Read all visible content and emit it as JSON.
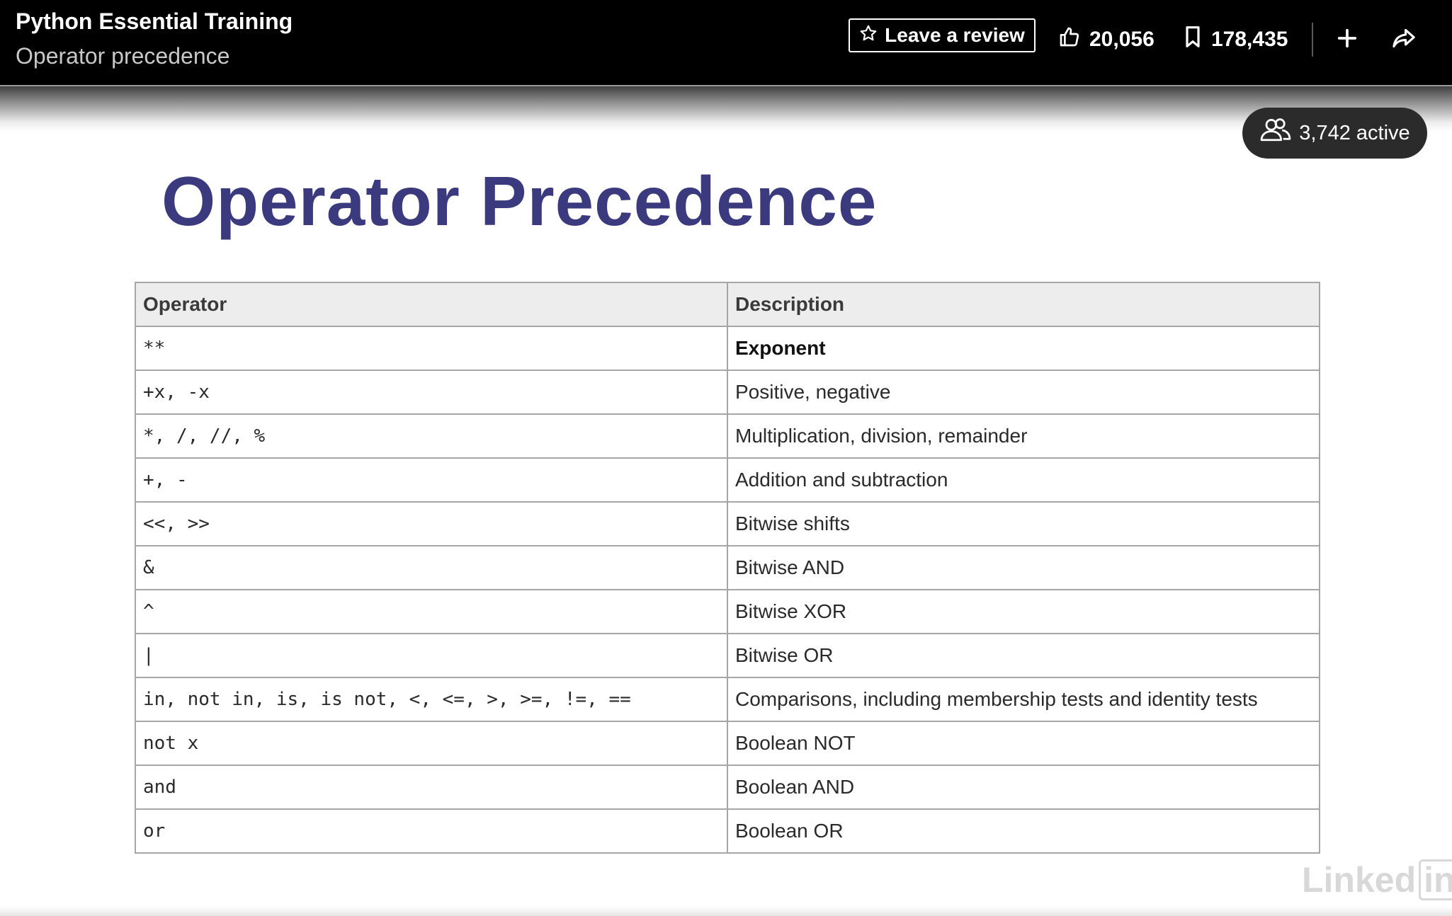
{
  "header": {
    "course_title": "Python Essential Training",
    "video_title": "Operator precedence",
    "review_label": "Leave a review",
    "likes": "20,056",
    "saves": "178,435"
  },
  "video": {
    "active_label": "3,742 active",
    "heading": "Operator Precedence",
    "table": {
      "headers": [
        "Operator",
        "Description"
      ],
      "rows": [
        {
          "operator": "**",
          "description": "Exponent"
        },
        {
          "operator": "+x, -x",
          "description": "Positive, negative"
        },
        {
          "operator": "*, /, //, %",
          "description": "Multiplication, division, remainder"
        },
        {
          "operator": "+, -",
          "description": "Addition and subtraction"
        },
        {
          "operator": "<<, >>",
          "description": "Bitwise shifts"
        },
        {
          "operator": "&",
          "description": "Bitwise AND"
        },
        {
          "operator": "^",
          "description": "Bitwise XOR"
        },
        {
          "operator": "|",
          "description": "Bitwise OR"
        },
        {
          "operator": "in, not in, is, is not, <, <=, >, >=, !=, ==",
          "description": "Comparisons, including membership tests and identity tests"
        },
        {
          "operator": "not x",
          "description": "Boolean NOT"
        },
        {
          "operator": "and",
          "description": "Boolean AND"
        },
        {
          "operator": "or",
          "description": "Boolean OR"
        }
      ]
    },
    "watermark": {
      "text": "Linked",
      "box_text": "in"
    }
  },
  "icons": {
    "review": "star-icon",
    "likes": "thumbs-up-icon",
    "saves": "bookmark-icon",
    "add": "plus-icon",
    "share": "share-arrow-icon",
    "active": "users-icon"
  },
  "colors": {
    "heading": "#3c3a7e",
    "topbar": "#000000",
    "table_header_bg": "#ededed",
    "table_border": "#a6a6a6"
  }
}
